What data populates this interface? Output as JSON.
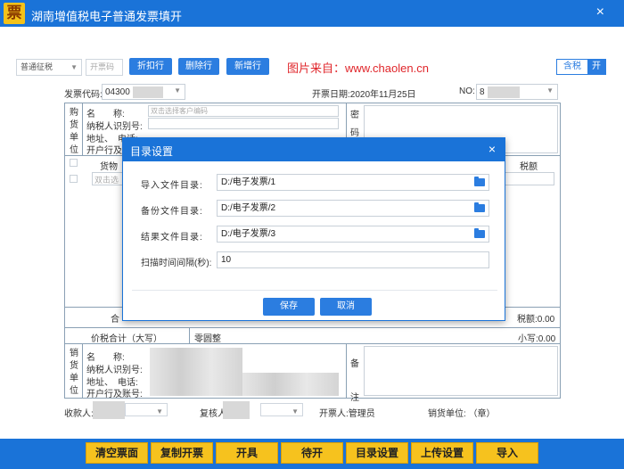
{
  "app": {
    "logo": "票",
    "title": "湖南增值税电子普通发票填开",
    "close": "×"
  },
  "toolbar": {
    "tax_type": "普通征税",
    "code_placeholder": "开票码",
    "discount_btn": "折扣行",
    "delete_btn": "删除行",
    "add_btn": "新增行",
    "watermark": "图片来自：www.chaolen.cn",
    "tax_incl_label": "含税",
    "tax_incl_state": "开"
  },
  "invoice": {
    "code_label": "发票代码:",
    "code_value": "04300",
    "date_label": "开票日期:2020年11月25日",
    "no_label": "NO:",
    "no_value": "8",
    "buyer_side": "购货单位",
    "buyer_name_label": "名　　称:",
    "buyer_name_placeholder": "双击选择客户编码",
    "buyer_tax_label": "纳税人识别号:",
    "buyer_addr_label": "地址、　电话:",
    "buyer_bank_label": "开户行及账号:",
    "secret_label": "密码区",
    "goods_header": "货物",
    "goods_placeholder": "双击选",
    "tax_amount_header": "税额",
    "total_label": "合",
    "tax_total": "税额:0.00",
    "price_tax_total_label": "价税合计（大写）",
    "price_tax_total_value": "零圆整",
    "small_total": "小写:0.00",
    "seller_side": "销货单位",
    "seller_name_label": "名　　称:",
    "seller_tax_label": "纳税人识别号:",
    "seller_addr_label": "地址、　电话:",
    "seller_bank_label": "开户行及账号:",
    "remark_label": "备注",
    "payee_label": "收款人:",
    "reviewer_label": "复核人",
    "drawer_label": "开票人:管理员",
    "seller_stamp_label": "销货单位: （章）"
  },
  "dialog": {
    "title": "目录设置",
    "close": "×",
    "import_label": "导入文件目录:",
    "import_value": "D:/电子发票/1",
    "backup_label": "备份文件目录:",
    "backup_value": "D:/电子发票/2",
    "result_label": "结果文件目录:",
    "result_value": "D:/电子发票/3",
    "interval_label": "扫描时间间隔(秒):",
    "interval_value": "10",
    "save": "保存",
    "cancel": "取消"
  },
  "bottom": {
    "clear": "清空票面",
    "copy": "复制开票",
    "issue": "开具",
    "pending": "待开",
    "dir_settings": "目录设置",
    "upload_settings": "上传设置",
    "import": "导入"
  },
  "colors": {
    "title_blue": "#1a73d8",
    "button_blue": "#2b7de0",
    "yellow": "#f6c21e",
    "watermark_red": "#e0262b"
  }
}
